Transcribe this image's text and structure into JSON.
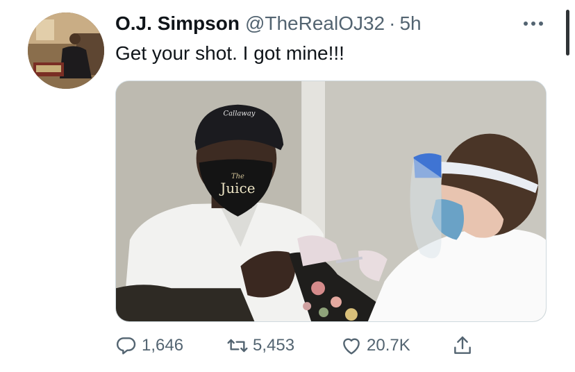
{
  "tweet": {
    "author_name": "O.J. Simpson",
    "handle": "@TheRealOJ32",
    "separator": "·",
    "time": "5h",
    "text": "Get your shot. I got mine!!!"
  },
  "media": {
    "mask_text_small": "The",
    "mask_text": "Juice",
    "cap_text": "Callaway"
  },
  "actions": {
    "replies": "1,646",
    "retweets": "5,453",
    "likes": "20.7K"
  },
  "icons": {
    "more": "more-horizontal-icon",
    "reply": "reply-icon",
    "retweet": "retweet-icon",
    "like": "heart-icon",
    "share": "share-icon"
  },
  "colors": {
    "text_primary": "#0f1419",
    "text_secondary": "#536471",
    "border": "#cfd9de"
  }
}
